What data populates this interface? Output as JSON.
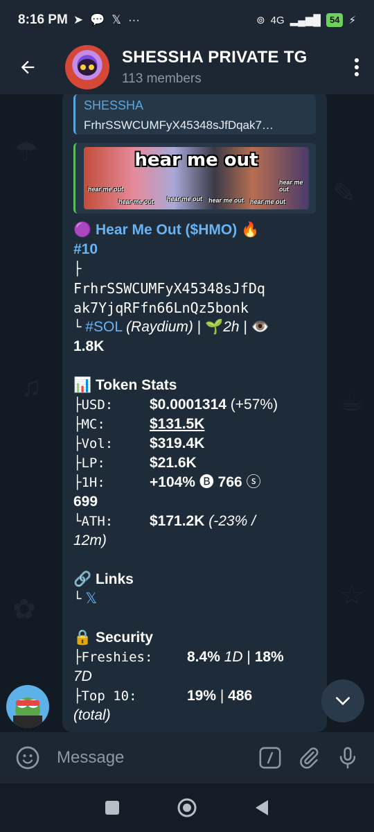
{
  "status_bar": {
    "time": "8:16 PM",
    "network": "4G",
    "battery": "54"
  },
  "header": {
    "title": "SHESSHA PRIVATE TG",
    "members": "113 members"
  },
  "reply": {
    "name": "SHESSHA",
    "text": "FrhrSSWCUMFyX45348sJfDqak7…"
  },
  "preview": {
    "headline": "hear me out",
    "tag": "hear me out"
  },
  "message": {
    "token_emoji": "🟣",
    "token_name": "Hear Me Out",
    "token_symbol": "($HMO)",
    "fire": "🔥",
    "rank": "#10",
    "branch_top": "├",
    "address_line1": "FrhrSSWCUMFyX45348sJfDq",
    "address_line2": "ak7YjqRFfn66LnQz5bonk",
    "branch_end": "└",
    "chain_tag": "#SOL",
    "dex": "(Raydium)",
    "sep": "|",
    "age_emoji": "🌱",
    "age": "2h",
    "eye_emoji": "👁️",
    "views": "1.8K",
    "stats_emoji": "📊",
    "stats_title": "Token Stats",
    "usd_key": "├USD:",
    "usd_val": "$0.0001314",
    "usd_change": "(+57%)",
    "mc_key": "├MC:",
    "mc_val": "$131.5K",
    "vol_key": "├Vol:",
    "vol_val": "$319.4K",
    "lp_key": "├LP:",
    "lp_val": "$21.6K",
    "h1_key": "├1H:",
    "h1_val": "+104%",
    "buy_icon": "🅑",
    "buys": "766",
    "sell_icon": "ⓢ",
    "sells": "699",
    "ath_key": "└ATH:",
    "ath_val": "$171.2K",
    "ath_change": "(-23% /",
    "ath_time": "12m)",
    "links_emoji": "🔗",
    "links_title": "Links",
    "links_branch": "└",
    "x_link": "𝕏",
    "security_emoji": "🔒",
    "security_title": "Security",
    "freshies_key": "├Freshies:",
    "freshies_val": "8.4%",
    "freshies_period": "1D",
    "freshies_val2": "18%",
    "freshies_period2": "7D",
    "top10_key": "├Top 10:",
    "top10_val": "19%",
    "top10_total": "486",
    "top10_note": "(total)"
  },
  "input": {
    "placeholder": "Message"
  },
  "colors": {
    "accent": "#6ab3f3",
    "bubble": "#1e2c3a",
    "header": "#1d2733"
  }
}
